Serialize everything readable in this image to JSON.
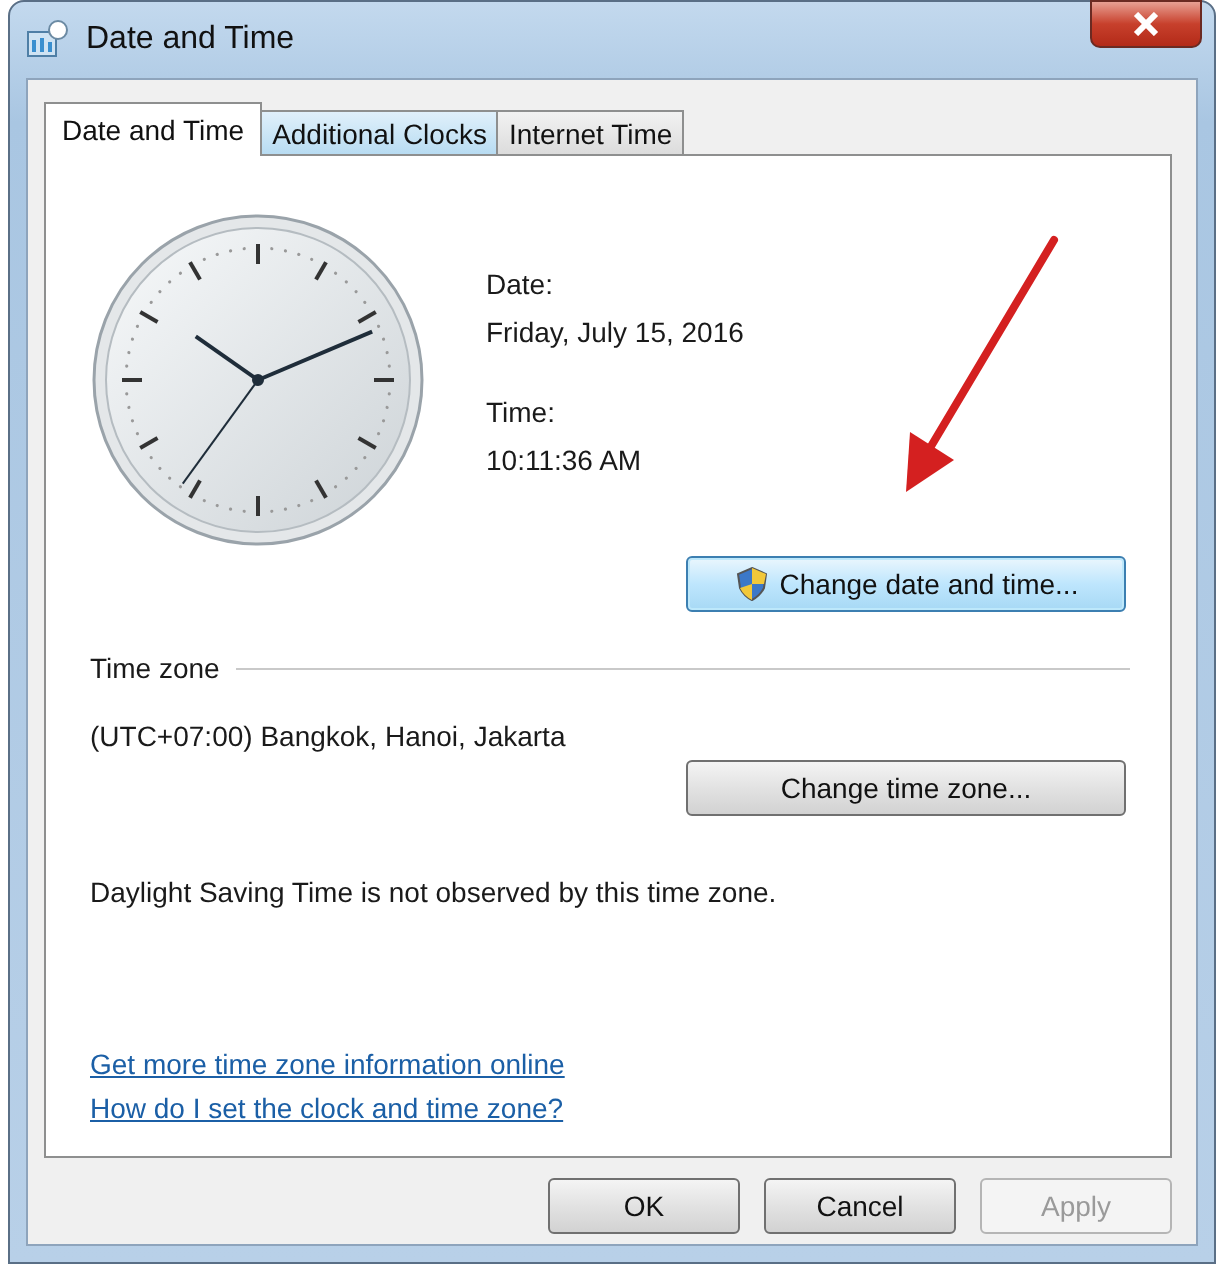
{
  "window": {
    "title": "Date and Time"
  },
  "tabs": [
    {
      "label": "Date and Time",
      "selected": true
    },
    {
      "label": "Additional Clocks",
      "selected": false
    },
    {
      "label": "Internet Time",
      "selected": false
    }
  ],
  "date": {
    "label": "Date:",
    "value": "Friday, July 15, 2016"
  },
  "time": {
    "label": "Time:",
    "value": "10:11:36 AM"
  },
  "change_date_button": {
    "label": "Change date and time...",
    "focused": true
  },
  "time_zone": {
    "heading": "Time zone",
    "value": "(UTC+07:00) Bangkok, Hanoi, Jakarta",
    "button": "Change time zone...",
    "dst_note": "Daylight Saving Time is not observed by this time zone."
  },
  "links": [
    "Get more time zone information online",
    "How do I set the clock and time zone?"
  ],
  "buttons": [
    {
      "label": "OK",
      "disabled": false
    },
    {
      "label": "Cancel",
      "disabled": false
    },
    {
      "label": "Apply",
      "disabled": true
    }
  ]
}
